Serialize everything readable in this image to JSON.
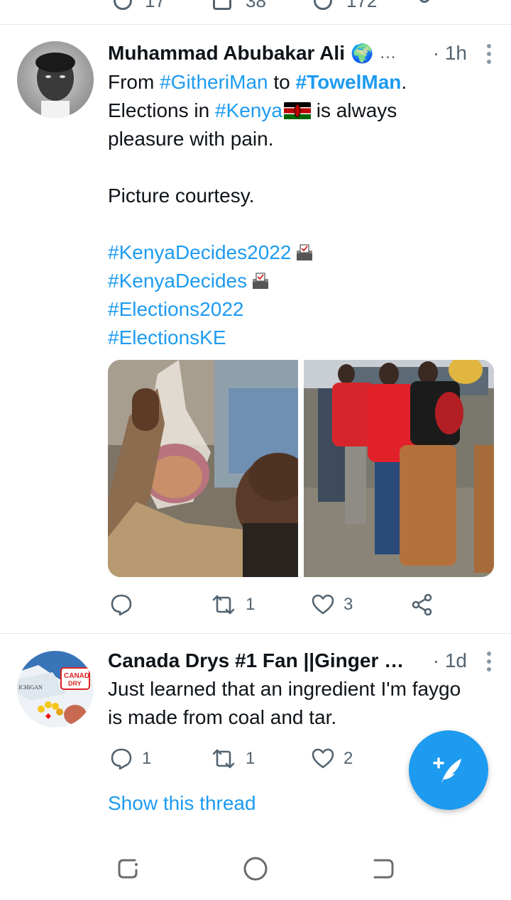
{
  "prev_tweet": {
    "counts": [
      "17",
      "38",
      "172"
    ]
  },
  "tweets": [
    {
      "author": "Muhammad Abubakar Ali",
      "ellipsis": "…",
      "time": "· 1h",
      "body": {
        "from": "From ",
        "tag1": "#GitheriMan",
        "to": " to ",
        "tag2": "#TowelMan",
        "period": ".",
        "line2_pre": "Elections in ",
        "tag3": "#Kenya",
        "line2_post": " is always",
        "line3": "pleasure with pain.",
        "line5": "Picture courtesy.",
        "tag4": "#KenyaDecides2022",
        "tag5": "#KenyaDecides",
        "tag6": "#Elections2022",
        "tag7": "#ElectionsKE"
      },
      "actions": {
        "replies": "",
        "retweets": "1",
        "likes": "3"
      }
    },
    {
      "author": "Canada Drys #1 Fan ||Ginger …",
      "time": "· 1d",
      "body": {
        "line1": "Just learned that an ingredient I'm faygo",
        "line2": "is made from coal and tar."
      },
      "actions": {
        "replies": "1",
        "retweets": "1",
        "likes": "2"
      },
      "show_thread": "Show this thread"
    }
  ],
  "colors": {
    "accent": "#1d9bf0",
    "muted": "#536471"
  }
}
